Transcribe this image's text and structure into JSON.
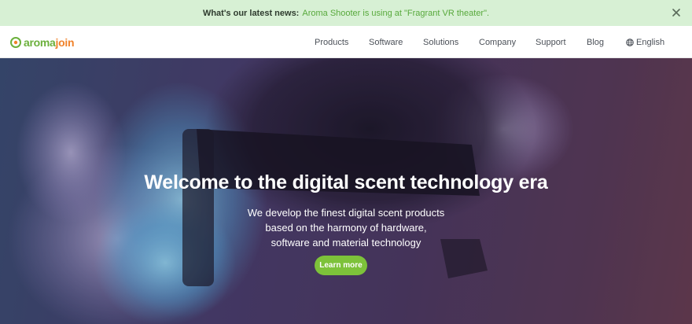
{
  "announcement": {
    "label": "What's our latest news:",
    "news_text": "Aroma Shooter is using at \"Fragrant VR theater\".",
    "close_icon": "close-icon"
  },
  "header": {
    "logo": {
      "part1": "aroma",
      "part2": "join",
      "icon": "aromajoin-logo-icon"
    },
    "nav": {
      "products": "Products",
      "software": "Software",
      "solutions": "Solutions",
      "company": "Company",
      "support": "Support",
      "blog": "Blog",
      "language": "English",
      "language_icon": "globe-icon"
    }
  },
  "hero": {
    "title": "Welcome to the digital scent technology era",
    "subtitle_lines": [
      "We develop the finest digital scent products",
      "based on the harmony of hardware,",
      "software and material technology"
    ],
    "cta_label": "Learn more"
  },
  "colors": {
    "announcement_bg": "#d7f0d4",
    "news_green": "#58a93c",
    "logo_green": "#6bb03c",
    "logo_orange": "#f0822a",
    "cta_green": "#7dc23a"
  }
}
